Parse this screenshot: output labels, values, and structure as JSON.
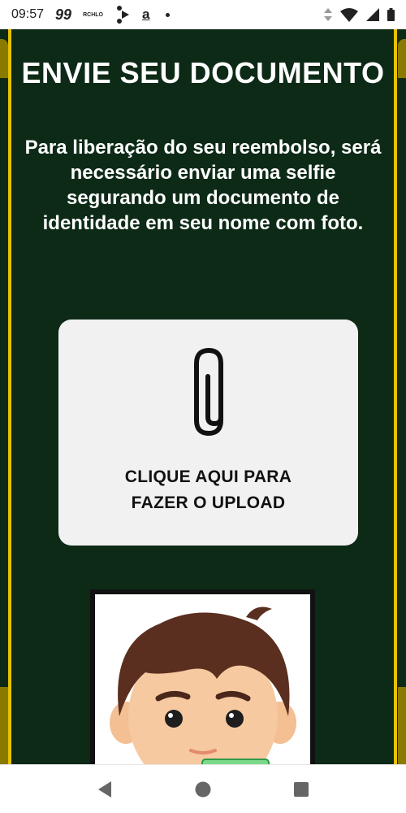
{
  "status_bar": {
    "time": "09:57",
    "app_badge": "99",
    "rchlo": "RCHLO",
    "amazon_glyph": "a",
    "icons": [
      "nav-arrow-icon",
      "amazon-icon",
      "dot-icon",
      "data-arrows-icon",
      "wifi-icon",
      "signal-icon",
      "battery-icon"
    ]
  },
  "main": {
    "title": "ENVIE SEU DOCUMENTO",
    "subtitle": "Para liberação do seu reembolso, será necessário enviar uma selfie segurando um documento de identidade em seu nome com foto.",
    "upload": {
      "icon": "paperclip-icon",
      "label_line1": "CLIQUE AQUI PARA",
      "label_line2": "FAZER O UPLOAD"
    }
  },
  "colors": {
    "background": "#0d2a17",
    "accent_yellow": "#e6c200",
    "card": "#f1f1f1"
  },
  "nav_bar": {
    "icons": [
      "back-icon",
      "home-icon",
      "recents-icon"
    ]
  }
}
